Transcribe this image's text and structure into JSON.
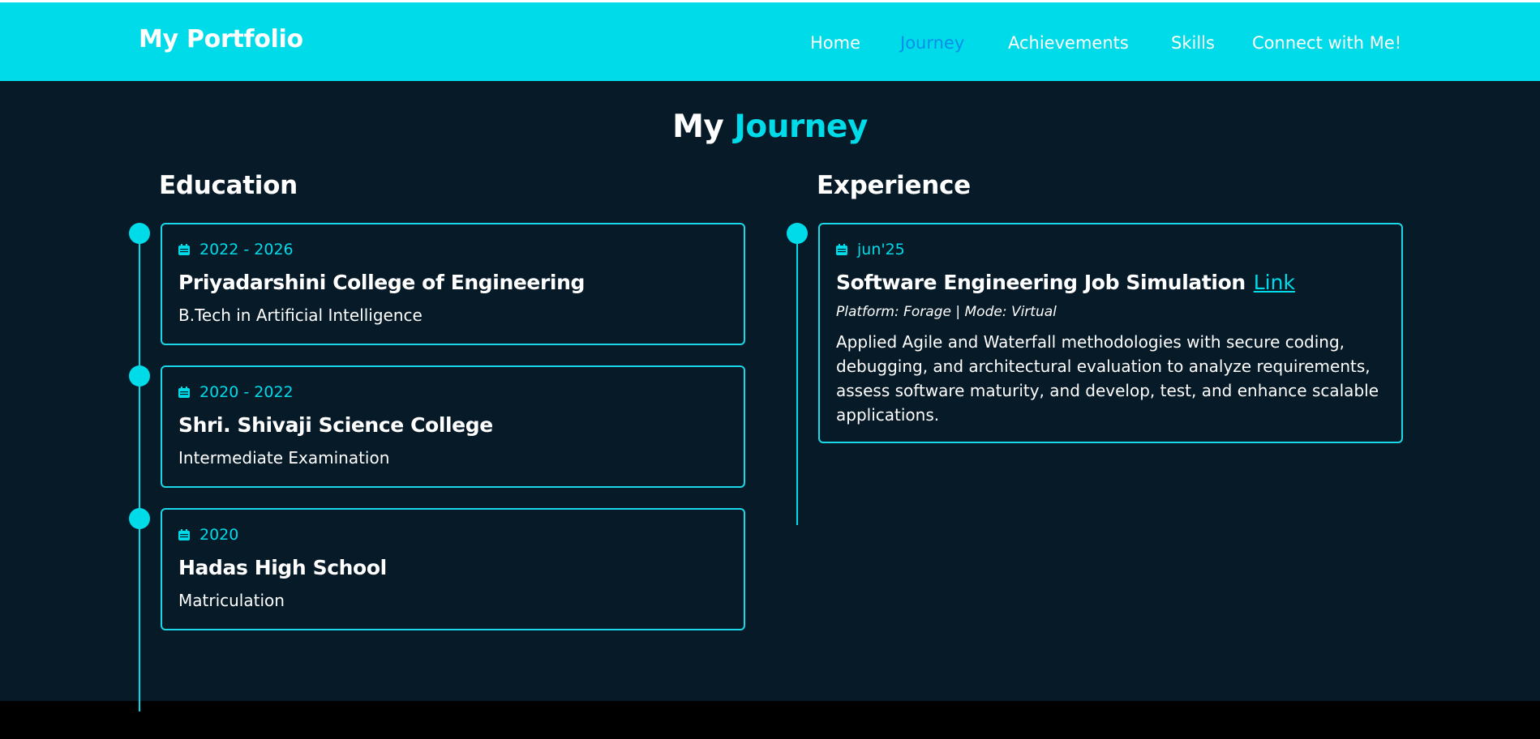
{
  "brand": "My Portfolio",
  "nav": {
    "items": [
      {
        "label": "Home",
        "active": false
      },
      {
        "label": "Journey",
        "active": true
      },
      {
        "label": "Achievements",
        "active": false
      },
      {
        "label": "Skills",
        "active": false
      },
      {
        "label": "Connect with Me!",
        "active": false
      }
    ]
  },
  "title": {
    "part1": "My",
    "part2": "Journey"
  },
  "education": {
    "heading": "Education",
    "items": [
      {
        "date": "2022 - 2026",
        "institution": "Priyadarshini College of Engineering",
        "detail": "B.Tech in Artificial Intelligence"
      },
      {
        "date": "2020 - 2022",
        "institution": "Shri. Shivaji Science College",
        "detail": "Intermediate Examination"
      },
      {
        "date": "2020",
        "institution": "Hadas High School",
        "detail": "Matriculation"
      }
    ]
  },
  "experience": {
    "heading": "Experience",
    "items": [
      {
        "date": "jun'25",
        "title": "Software Engineering Job Simulation",
        "link_label": "Link",
        "meta": "Platform: Forage | Mode: Virtual",
        "description": "Applied Agile and Waterfall methodologies with secure coding, debugging, and architectural evaluation to analyze requirements, assess software maturity, and develop, test, and enhance scalable applications."
      }
    ]
  },
  "colors": {
    "accent": "#00dbea",
    "active_nav": "#0a8fe8",
    "background": "#071a28"
  },
  "icons": {
    "date": "calendar-icon"
  }
}
